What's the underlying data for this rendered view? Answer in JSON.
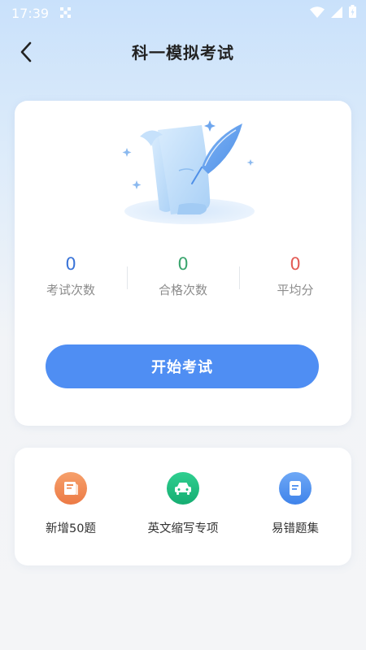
{
  "status_bar": {
    "time": "17:39"
  },
  "nav": {
    "title": "科一模拟考试"
  },
  "stats": [
    {
      "value": "0",
      "label": "考试次数",
      "color": "#3a74d8"
    },
    {
      "value": "0",
      "label": "合格次数",
      "color": "#3aa56e"
    },
    {
      "value": "0",
      "label": "平均分",
      "color": "#e35b55"
    }
  ],
  "start_button": {
    "label": "开始考试"
  },
  "tools": [
    {
      "label": "新增50题",
      "icon": "book-icon",
      "color": "#ef8a55"
    },
    {
      "label": "英文缩写专项",
      "icon": "car-icon",
      "color": "#1fba80"
    },
    {
      "label": "易错题集",
      "icon": "note-icon",
      "color": "#4c8ff0"
    }
  ],
  "colors": {
    "accent": "#4f8ef3",
    "background": "#f4f5f7"
  }
}
